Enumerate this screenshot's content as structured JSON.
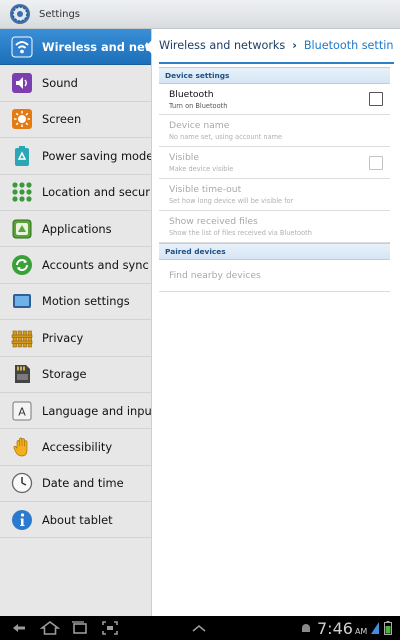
{
  "app": {
    "title": "Settings",
    "icon": "settings-gear-icon"
  },
  "sidebar": {
    "items": [
      {
        "label": "Wireless and networks",
        "icon": "wifi-icon",
        "selected": true
      },
      {
        "label": "Sound",
        "icon": "speaker-icon"
      },
      {
        "label": "Screen",
        "icon": "brightness-icon"
      },
      {
        "label": "Power saving mode",
        "icon": "battery-recycle-icon"
      },
      {
        "label": "Location and security",
        "icon": "location-grid-icon"
      },
      {
        "label": "Applications",
        "icon": "applications-icon"
      },
      {
        "label": "Accounts and sync",
        "icon": "sync-icon"
      },
      {
        "label": "Motion settings",
        "icon": "motion-tablet-icon"
      },
      {
        "label": "Privacy",
        "icon": "privacy-fence-icon"
      },
      {
        "label": "Storage",
        "icon": "sd-card-icon"
      },
      {
        "label": "Language and input",
        "icon": "keyboard-a-icon"
      },
      {
        "label": "Accessibility",
        "icon": "hand-icon"
      },
      {
        "label": "Date and time",
        "icon": "clock-icon"
      },
      {
        "label": "About tablet",
        "icon": "info-icon"
      }
    ]
  },
  "breadcrumb": {
    "parent": "Wireless and networks",
    "separator": "›",
    "current": "Bluetooth settings"
  },
  "sections": {
    "device_settings": "Device settings",
    "paired_devices": "Paired devices"
  },
  "rows": {
    "bluetooth": {
      "title": "Bluetooth",
      "subtitle": "Turn on Bluetooth",
      "checked": false,
      "enabled": true
    },
    "device_name": {
      "title": "Device name",
      "subtitle": "No name set, using account name",
      "enabled": false
    },
    "visible": {
      "title": "Visible",
      "subtitle": "Make device visible",
      "checked": false,
      "enabled": false
    },
    "visible_timeout": {
      "title": "Visible time-out",
      "subtitle": "Set how long device will be visible for",
      "enabled": false
    },
    "show_received": {
      "title": "Show received files",
      "subtitle": "Show the list of files received via Bluetooth",
      "enabled": false
    },
    "find_nearby": {
      "title": "Find nearby devices",
      "enabled": false
    }
  },
  "statusbar": {
    "time": "7:46",
    "ampm": "AM"
  },
  "colors": {
    "accent": "#1f78c8",
    "selected_bg": "#2a7fc9",
    "sidebar_bg": "#e7e7e7"
  }
}
